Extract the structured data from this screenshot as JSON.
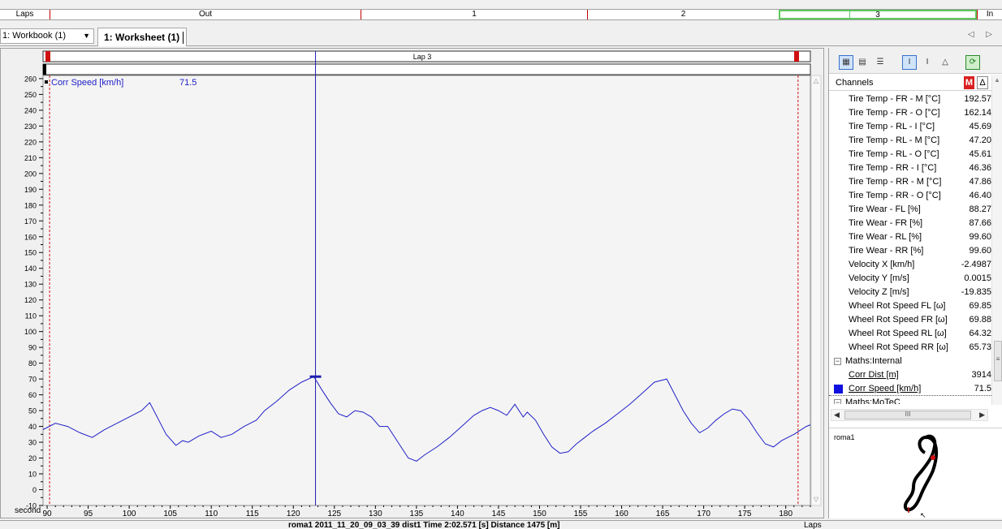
{
  "lapbar": {
    "label": "Laps",
    "laps": [
      {
        "label": "Out",
        "selected": false
      },
      {
        "label": "1",
        "selected": false
      },
      {
        "label": "2",
        "selected": false
      },
      {
        "label": "3",
        "selected": true
      },
      {
        "label": "In",
        "selected": false
      }
    ]
  },
  "toolbar": {
    "workbook": "1: Workbook (1)",
    "worksheet": "1: Worksheet (1)",
    "nav": "◁ ▷"
  },
  "chart_data": {
    "type": "line",
    "title": "",
    "lap_label": "Lap 3",
    "channel_label": "Corr Speed [km/h]",
    "cursor_value": "71.5",
    "xlabel": "second",
    "ylabel": "",
    "xlim": [
      89.5,
      183
    ],
    "ylim": [
      -10,
      262
    ],
    "xticks": [
      90,
      95,
      100,
      105,
      110,
      115,
      120,
      125,
      130,
      135,
      140,
      145,
      150,
      155,
      160,
      165,
      170,
      175,
      180
    ],
    "yticks": [
      -10,
      0,
      10,
      20,
      30,
      40,
      50,
      60,
      70,
      80,
      90,
      100,
      110,
      120,
      130,
      140,
      150,
      160,
      170,
      180,
      190,
      200,
      210,
      220,
      230,
      240,
      250,
      260
    ],
    "cursor_x": 122.7,
    "marker_x": [
      90.3,
      181.5
    ],
    "series": [
      {
        "color": "#2020c8",
        "x": [
          89.5,
          91,
          92.5,
          94,
          95.5,
          97,
          98.5,
          100,
          101.5,
          102.5,
          103.5,
          104.5,
          105.7,
          106.5,
          107.2,
          108.5,
          110,
          111.2,
          112.5,
          114,
          115.5,
          116.5,
          118,
          119.5,
          121,
          122.5,
          123.5,
          124.5,
          125.5,
          126.5,
          127.5,
          128.5,
          129.5,
          130.5,
          131.5,
          133,
          134,
          135,
          136,
          137.5,
          139,
          140.5,
          142,
          143,
          144,
          145,
          146,
          147,
          148,
          148.5,
          149.5,
          150.5,
          151.5,
          152.5,
          153.5,
          154.5,
          155.5,
          156.5,
          158,
          159.5,
          161,
          162.5,
          164,
          165.5,
          166.5,
          167.5,
          168.5,
          169.5,
          170.5,
          171.5,
          172.5,
          173.5,
          174.5,
          175.5,
          176.5,
          177.5,
          178.5,
          179.5,
          181,
          182.5,
          183
        ],
        "y": [
          38,
          42,
          40,
          36,
          33,
          38,
          42,
          46,
          50,
          55,
          45,
          35,
          28,
          31,
          30,
          34,
          37,
          33,
          35,
          40,
          44,
          50,
          56,
          63,
          68,
          71.5,
          63,
          55,
          48,
          46,
          50,
          49,
          46,
          40,
          40,
          28,
          20,
          18,
          22,
          27,
          33,
          40,
          47,
          50,
          52,
          50,
          47,
          54,
          46,
          49,
          44,
          35,
          27,
          23,
          24,
          29,
          33,
          37,
          42,
          48,
          54,
          61,
          68,
          70,
          60,
          50,
          42,
          36,
          39,
          44,
          48,
          51,
          50,
          44,
          36,
          29,
          27,
          31,
          35,
          40,
          41
        ]
      }
    ]
  },
  "channels": {
    "header": "Channels",
    "m_label": "M",
    "delta_label": "Δ",
    "items": [
      {
        "name": "Tire Temp - FR - M [°C]",
        "value": "192.57"
      },
      {
        "name": "Tire Temp - FR - O [°C]",
        "value": "162.14"
      },
      {
        "name": "Tire Temp - RL - I [°C]",
        "value": "45.69"
      },
      {
        "name": "Tire Temp - RL - M [°C]",
        "value": "47.20"
      },
      {
        "name": "Tire Temp - RL - O [°C]",
        "value": "45.61"
      },
      {
        "name": "Tire Temp - RR - I [°C]",
        "value": "46.36"
      },
      {
        "name": "Tire Temp - RR - M [°C]",
        "value": "47.86"
      },
      {
        "name": "Tire Temp - RR - O [°C]",
        "value": "46.40"
      },
      {
        "name": "Tire Wear - FL [%]",
        "value": "88.27"
      },
      {
        "name": "Tire Wear - FR [%]",
        "value": "87.66"
      },
      {
        "name": "Tire Wear - RL [%]",
        "value": "99.60"
      },
      {
        "name": "Tire Wear - RR [%]",
        "value": "99.60"
      },
      {
        "name": "Velocity X [km/h]",
        "value": "-2.4987"
      },
      {
        "name": "Velocity Y [m/s]",
        "value": "0.0015"
      },
      {
        "name": "Velocity Z [m/s]",
        "value": "-19.835"
      },
      {
        "name": "Wheel Rot Speed FL [ω]",
        "value": "69.85"
      },
      {
        "name": "Wheel Rot Speed FR [ω]",
        "value": "69.88"
      },
      {
        "name": "Wheel Rot Speed RL [ω]",
        "value": "64.32"
      },
      {
        "name": "Wheel Rot Speed RR [ω]",
        "value": "65.73"
      }
    ],
    "group_internal": "Maths:Internal",
    "maths_items": [
      {
        "name": "Corr Dist [m]",
        "value": "3914"
      },
      {
        "name": "Corr Speed [km/h]",
        "value": "71.5"
      }
    ],
    "group_motec": "Maths:MoTeC",
    "hscroll_grip": "III",
    "vscroll_grip": "≡"
  },
  "track": {
    "name": "roma1"
  },
  "status": {
    "text": "roma1 2011_11_20_09_03_39 dist1 Time 2:02.571 [s]   Distance 1475 [m]",
    "right": "Laps"
  }
}
